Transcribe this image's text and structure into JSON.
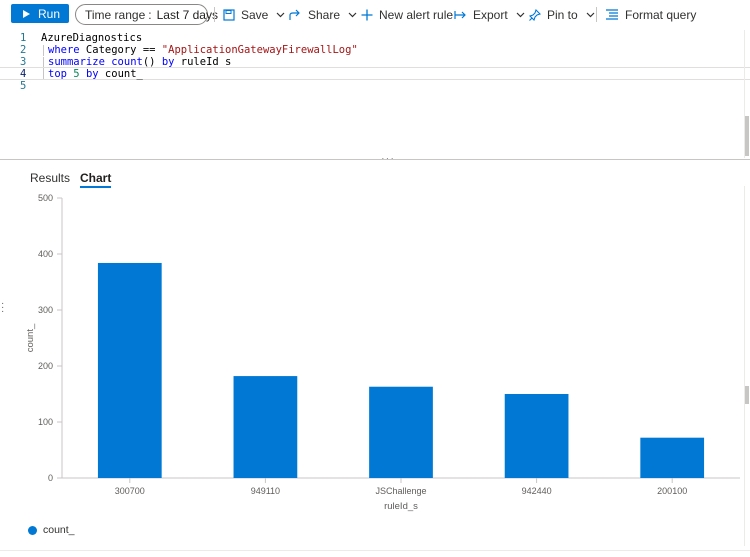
{
  "toolbar": {
    "run_label": "Run",
    "time_range_label": "Time range",
    "time_range_sep": ":",
    "time_range_value": "Last 7 days",
    "save_label": "Save",
    "share_label": "Share",
    "new_alert_label": "New alert rule",
    "export_label": "Export",
    "pin_label": "Pin to",
    "format_label": "Format query"
  },
  "editor": {
    "lines": [
      {
        "number": "1",
        "text": "AzureDiagnostics"
      },
      {
        "number": "2",
        "kw": "where",
        "rest": " Category == ",
        "str": "\"ApplicationGatewayFirewallLog\""
      },
      {
        "number": "3",
        "kw": "summarize",
        "rest1": " ",
        "kw2": "count",
        "rest2": "() ",
        "kw3": "by",
        "rest3": " ruleId_s"
      },
      {
        "number": "4",
        "kw": "top",
        "rest1": " ",
        "num": "5",
        "rest2": " ",
        "kw2": "by",
        "rest3": " count_"
      },
      {
        "number": "5"
      }
    ]
  },
  "tabs": {
    "results": "Results",
    "chart": "Chart"
  },
  "chart_data": {
    "type": "bar",
    "categories": [
      "300700",
      "949110",
      "JSChallenge",
      "942440",
      "200100"
    ],
    "series": [
      {
        "name": "count_",
        "values": [
          384,
          182,
          163,
          150,
          72
        ]
      }
    ],
    "xlabel": "ruleId_s",
    "ylabel": "count_",
    "ylim": [
      0,
      500
    ],
    "yticks": [
      0,
      100,
      200,
      300,
      400,
      500
    ],
    "color": "#0078d4",
    "grid": false,
    "legend": "bottom-left"
  }
}
